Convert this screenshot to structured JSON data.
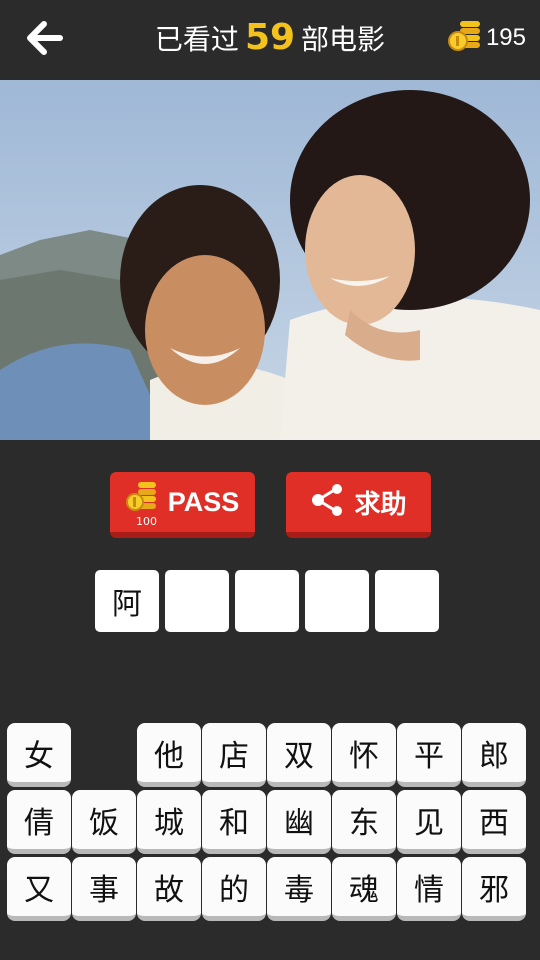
{
  "header": {
    "title_prefix": "已看过",
    "watched_count": "59",
    "title_suffix": "部电影",
    "coins": "195"
  },
  "actions": {
    "pass_label": "PASS",
    "pass_cost": "100",
    "help_label": "求助"
  },
  "answer_slots": [
    "阿",
    "",
    "",
    "",
    ""
  ],
  "keyboard": [
    [
      "女",
      "",
      "他",
      "店",
      "双",
      "怀",
      "平",
      "郎"
    ],
    [
      "倩",
      "饭",
      "城",
      "和",
      "幽",
      "东",
      "见",
      "西"
    ],
    [
      "又",
      "事",
      "故",
      "的",
      "毒",
      "魂",
      "情",
      "邪"
    ]
  ],
  "colors": {
    "accent": "#f4c21d",
    "button": "#e02f26",
    "background": "#2b2b2b"
  }
}
